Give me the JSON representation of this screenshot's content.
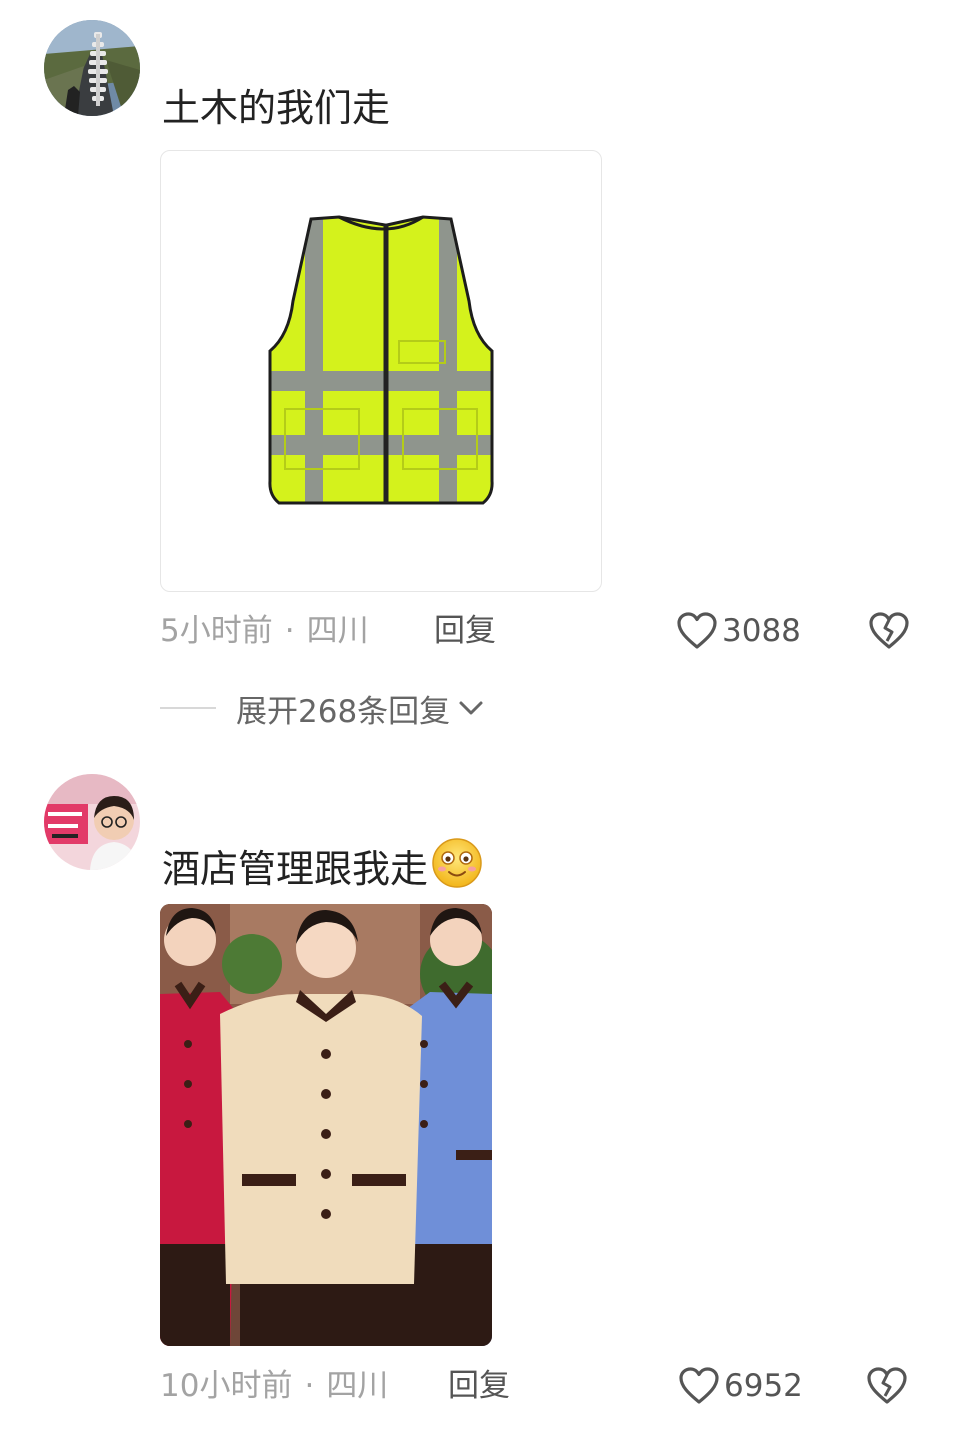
{
  "comments": [
    {
      "text": "土木的我们走",
      "time": "5小时前",
      "separator": "·",
      "location": "四川",
      "reply_label": "回复",
      "like_count": "3088",
      "expand_label": "展开268条回复",
      "image_icon": "safety-vest"
    },
    {
      "text": "酒店管理跟我走",
      "emoji": "smiling-face-emoji",
      "time": "10小时前",
      "separator": "·",
      "location": "四川",
      "reply_label": "回复",
      "like_count": "6952",
      "image_icon": "hotel-uniform-staff"
    }
  ],
  "colors": {
    "meta_gray": "#a3a3a3",
    "text_dark": "#222222",
    "vest_yellow": "#d4f21c",
    "reflective_gray": "#8f958d"
  }
}
